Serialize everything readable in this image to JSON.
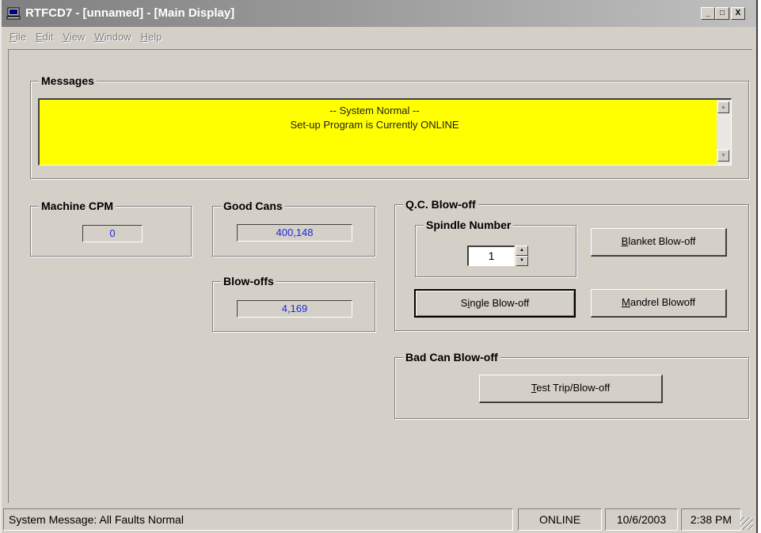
{
  "window": {
    "title": "RTFCD7 - [unnamed] - [Main Display]",
    "minimize": "_",
    "maximize": "□",
    "close": "X"
  },
  "menu": [
    {
      "first": "F",
      "rest": "ile"
    },
    {
      "first": "E",
      "rest": "dit"
    },
    {
      "first": "V",
      "rest": "iew"
    },
    {
      "first": "W",
      "rest": "indow"
    },
    {
      "first": "H",
      "rest": "elp"
    }
  ],
  "messages": {
    "label": "Messages",
    "line1": "-- System Normal --",
    "line2": "Set-up Program is Currently ONLINE"
  },
  "machine_cpm": {
    "label": "Machine CPM",
    "value": "0"
  },
  "good_cans": {
    "label": "Good Cans",
    "value": "400,148"
  },
  "blow_offs": {
    "label": "Blow-offs",
    "value": "4,169"
  },
  "qc": {
    "label": "Q.C. Blow-off",
    "spindle_label": "Spindle Number",
    "spindle_value": "1",
    "blanket": {
      "pre": "",
      "ul": "B",
      "post": "lanket Blow-off"
    },
    "single": {
      "pre": "S",
      "ul": "i",
      "post": "ngle Blow-off"
    },
    "mandrel": {
      "pre": "",
      "ul": "M",
      "post": "andrel Blowoff"
    }
  },
  "bad_can": {
    "label": "Bad Can Blow-off",
    "test": {
      "pre": "",
      "ul": "T",
      "post": "est Trip/Blow-off"
    }
  },
  "status": {
    "message": "System Message:  All Faults Normal",
    "state": "ONLINE",
    "date": "10/6/2003",
    "time": "2:38 PM"
  },
  "colors": {
    "message_bg": "#ffff00",
    "readout_text": "#1c2bd8"
  }
}
